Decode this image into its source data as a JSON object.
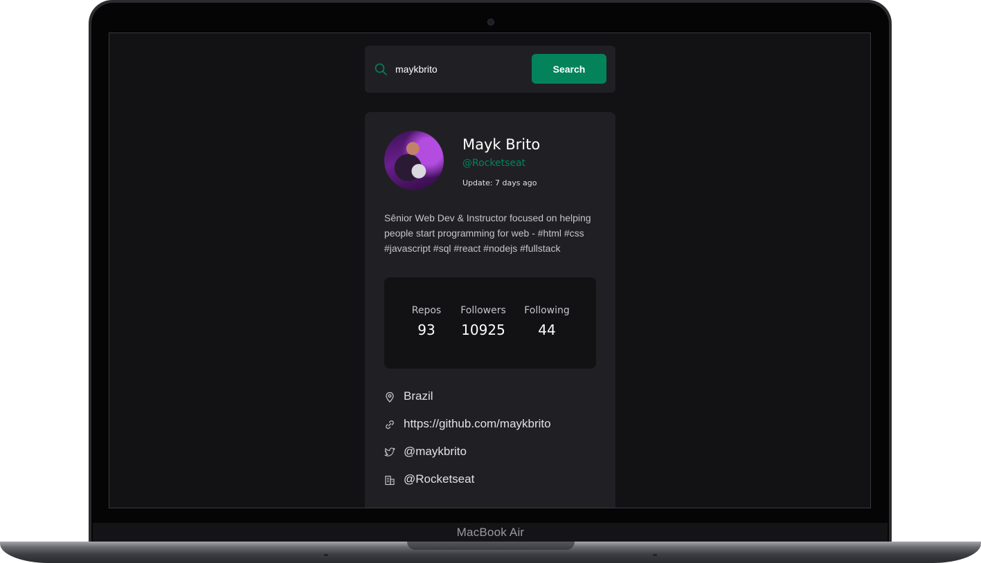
{
  "search": {
    "value": "maykbrito",
    "button_label": "Search"
  },
  "profile": {
    "name": "Mayk Brito",
    "company_handle": "@Rocketseat",
    "updated": "Update: 7 days ago",
    "bio": "Sênior Web Dev & Instructor focused on helping people start programming for web - #html #css #javascript #sql #react #nodejs #fullstack"
  },
  "stats": [
    {
      "label": "Repos",
      "value": "93"
    },
    {
      "label": "Followers",
      "value": "10925"
    },
    {
      "label": "Following",
      "value": "44"
    }
  ],
  "info": [
    {
      "icon": "map-pin-icon",
      "text": "Brazil"
    },
    {
      "icon": "link-icon",
      "text": "https://github.com/maykbrito"
    },
    {
      "icon": "twitter-icon",
      "text": "@maykbrito"
    },
    {
      "icon": "building-icon",
      "text": "@Rocketseat"
    }
  ],
  "device": {
    "model_label": "MacBook Air"
  },
  "colors": {
    "accent": "#04835a",
    "background": "#121214",
    "card": "#202024"
  }
}
